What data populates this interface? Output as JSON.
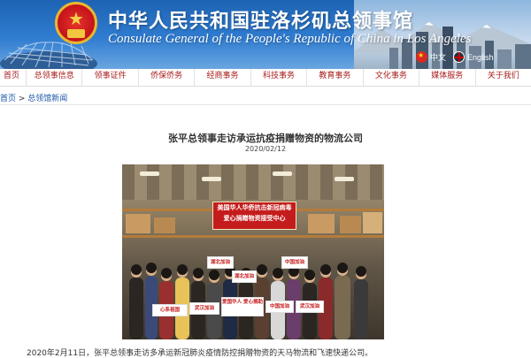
{
  "header": {
    "title_cn": "中华人民共和国驻洛杉矶总领事馆",
    "title_en": "Consulate General of the People's Republic of China in Los Angeles",
    "languages": [
      {
        "label": "中文",
        "icon": "china-flag-icon"
      },
      {
        "label": "English",
        "icon": "uk-flag-icon"
      }
    ]
  },
  "nav": {
    "items": [
      "首页",
      "总领事信息",
      "领事证件",
      "侨保侨务",
      "经商事务",
      "科技事务",
      "教育事务",
      "文化事务",
      "媒体服务",
      "关于我们"
    ]
  },
  "breadcrumb": {
    "home": "首页",
    "separator": " > ",
    "section": "总领馆新闻"
  },
  "article": {
    "title": "张平总领事走访承运抗疫捐赠物资的物流公司",
    "date": "2020/02/12",
    "photo": {
      "banner_line1": "美国华人华侨抗击新冠病毒",
      "banner_line2": "爱心捐赠物资接受中心",
      "signs": [
        "心系祖国",
        "武汉加油",
        "爱国华人 爱心捐助",
        "中国加油",
        "湖北加油",
        "湖北加油",
        "中国加油",
        "武汉加油"
      ]
    },
    "body_first_line": "2020年2月11日，张平总领事走访多承运新冠肺炎疫情防控捐赠物资的天马物流和飞速快递公司。"
  },
  "colors": {
    "nav_text": "#a81c1c",
    "link": "#1a56a8",
    "banner_blue": "#2f7cd0"
  }
}
